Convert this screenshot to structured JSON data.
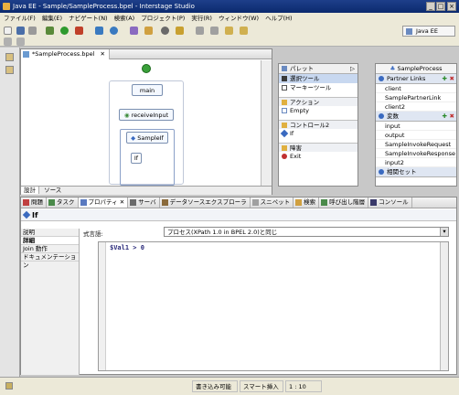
{
  "window": {
    "title": "Java EE - Sample/SampleProcess.bpel - Interstage Studio"
  },
  "menu": [
    "ファイル(F)",
    "編集(E)",
    "ナビゲート(N)",
    "検索(A)",
    "プロジェクト(P)",
    "実行(R)",
    "ウィンドウ(W)",
    "ヘルプ(H)"
  ],
  "perspective": {
    "label": "Java EE"
  },
  "editor": {
    "tab": "*SampleProcess.bpel",
    "nodes": {
      "main": "main",
      "receive": "receiveInput",
      "if": "SampleIf",
      "if_case": "If"
    },
    "bottom_tabs": [
      "設計",
      "ソース"
    ]
  },
  "palette": {
    "title": "パレット",
    "tools": [
      "選択ツール",
      "マーキーツール"
    ],
    "sections": [
      {
        "name": "アクション",
        "items": [
          "Empty"
        ]
      },
      {
        "name": "コントロール2",
        "items": [
          "If"
        ]
      },
      {
        "name": "障害",
        "items": [
          "Exit"
        ]
      }
    ]
  },
  "process_panel": {
    "title": "SampleProcess",
    "partner_links_label": "Partner Links",
    "partner_links": [
      "client",
      "SamplePartnerLink",
      "client2"
    ],
    "variables_label": "変数",
    "variables": [
      "input",
      "output",
      "SampleInvokeRequest",
      "SampleInvokeResponse",
      "input2"
    ],
    "correlation_label": "相関セット"
  },
  "bottom_tabs": [
    "問題",
    "タスク",
    "プロパティ",
    "サーバ",
    "データソースエクスプローラ",
    "スニペット",
    "検索",
    "呼び出し階層",
    "コンソール"
  ],
  "properties": {
    "title": "If",
    "tabs": [
      "説明",
      "詳細",
      "Join 動作",
      "ドキュメンテーション"
    ],
    "expression_label": "式言語:",
    "expression_value": "プロセス(XPath 1.0 in BPEL 2.0)と同じ",
    "code": "$Val1 > 0"
  },
  "status": {
    "writable": "書き込み可能",
    "insert_mode": "スマート挿入",
    "position": "1 : 10"
  }
}
